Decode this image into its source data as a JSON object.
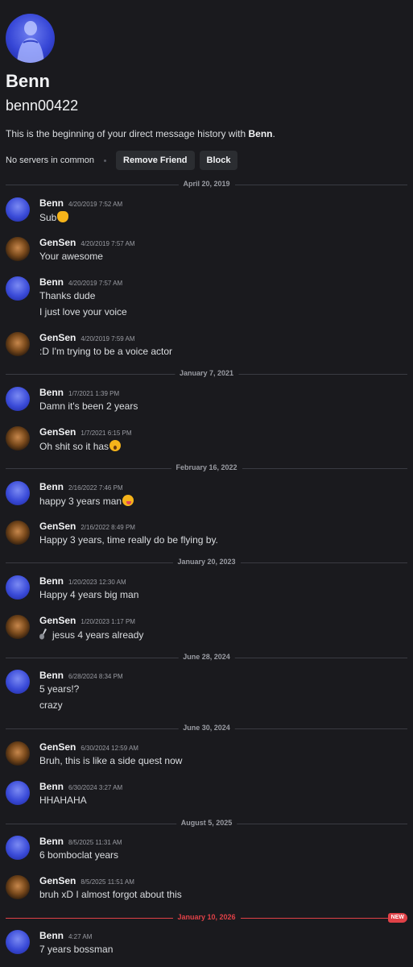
{
  "profile": {
    "display_name": "Benn",
    "username": "benn00422",
    "intro_prefix": "This is the beginning of your direct message history with",
    "intro_name": "Benn",
    "intro_suffix": ".",
    "no_servers": "No servers in common",
    "remove_friend_label": "Remove Friend",
    "block_label": "Block"
  },
  "dividers": [
    "April 20, 2019",
    "January 7, 2021",
    "February 16, 2022",
    "January 20, 2023",
    "June 28, 2024",
    "June 30, 2024",
    "August 5, 2025",
    "January 10, 2026"
  ],
  "new_badge": "NEW",
  "messages": [
    {
      "author": "Benn",
      "time": "4/20/2019 7:52 AM",
      "lines": [
        "Sub"
      ],
      "emoji": "ok-hand-emoji"
    },
    {
      "author": "GenSen",
      "time": "4/20/2019 7:57 AM",
      "lines": [
        "Your awesome"
      ]
    },
    {
      "author": "Benn",
      "time": "4/20/2019 7:57 AM",
      "lines": [
        "Thanks dude",
        "I just love your voice"
      ]
    },
    {
      "author": "GenSen",
      "time": "4/20/2019 7:59 AM",
      "lines": [
        ":D I'm trying to be a voice actor"
      ]
    },
    {
      "author": "Benn",
      "time": "1/7/2021 1:39 PM",
      "lines": [
        "Damn it's been 2 years"
      ]
    },
    {
      "author": "GenSen",
      "time": "1/7/2021 6:15 PM",
      "lines": [
        "Oh shit so it has"
      ],
      "emoji": "astonished-emoji"
    },
    {
      "author": "Benn",
      "time": "2/16/2022 7:46 PM",
      "lines": [
        "happy 3 years man"
      ],
      "emoji": "yum-emoji"
    },
    {
      "author": "GenSen",
      "time": "2/16/2022 8:49 PM",
      "lines": [
        "Happy 3 years, time really do be flying by."
      ]
    },
    {
      "author": "Benn",
      "time": "1/20/2023 12:30 AM",
      "lines": [
        "Happy 4 years big man"
      ]
    },
    {
      "author": "GenSen",
      "time": "1/20/2023 1:17 PM",
      "lines": [
        "jesus 4 years already"
      ]
    },
    {
      "author": "Benn",
      "time": "6/28/2024 8:34 PM",
      "lines": [
        "5 years!?",
        "crazy"
      ]
    },
    {
      "author": "GenSen",
      "time": "6/30/2024 12:59 AM",
      "lines": [
        "Bruh, this is like a side quest now"
      ]
    },
    {
      "author": "Benn",
      "time": "6/30/2024 3:27 AM",
      "lines": [
        "HHAHAHA"
      ]
    },
    {
      "author": "Benn",
      "time": "8/5/2025 11:31 AM",
      "lines": [
        "6 bomboclat years"
      ]
    },
    {
      "author": "GenSen",
      "time": "8/5/2025 11:51 AM",
      "lines": [
        "bruh xD I almost forgot about this"
      ]
    },
    {
      "author": "Benn",
      "time": "4:27 AM",
      "lines": [
        "7 years bossman"
      ]
    }
  ]
}
